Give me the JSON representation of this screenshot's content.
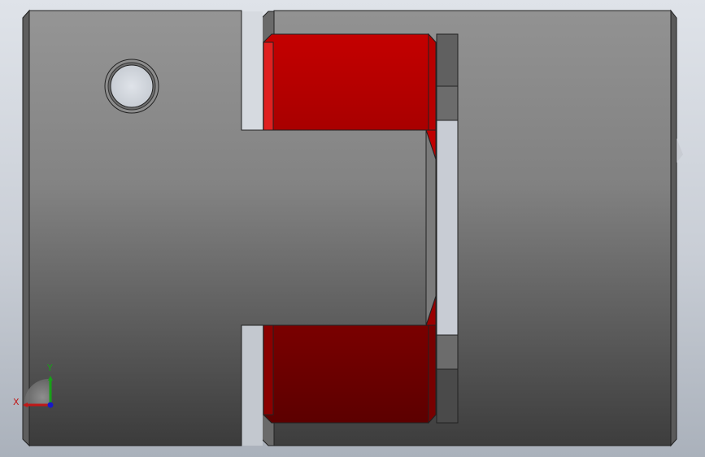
{
  "viewport": {
    "background_top": "#dfe3e9",
    "background_bottom": "#aab1bb"
  },
  "model": {
    "hub_color_light": "#8f8f8f",
    "hub_color_dark": "#3f3f3f",
    "spider_color_light": "#c00000",
    "spider_color_dark": "#650000"
  },
  "triad": {
    "x_label": "X",
    "y_label": "Y",
    "x_color": "#c01818",
    "y_color": "#18a018",
    "z_color": "#1818c8"
  }
}
